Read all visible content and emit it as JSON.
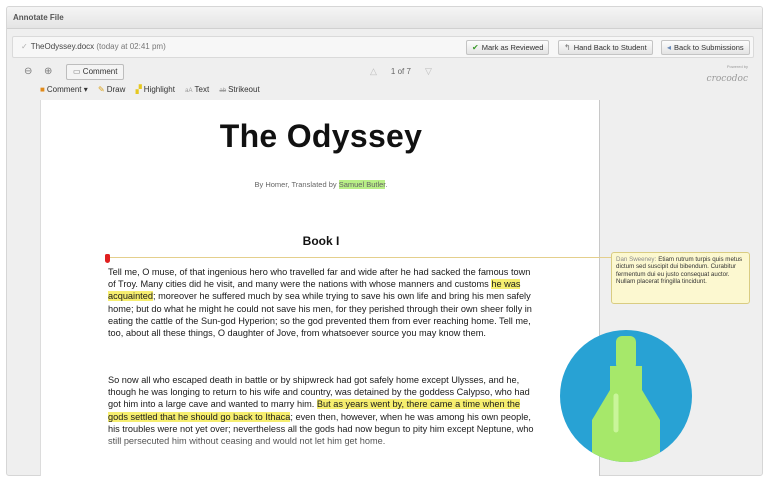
{
  "window": {
    "title": "Annotate File"
  },
  "file_bar": {
    "file_name": "TheOdyssey.docx",
    "timestamp": "(today at 02:41 pm)",
    "buttons": {
      "mark_reviewed": "Mark as Reviewed",
      "hand_back": "Hand Back to Student",
      "back_submissions": "Back to Submissions"
    }
  },
  "toolbar": {
    "comment_label": "Comment",
    "page_indicator": "1 of 7",
    "brand_powered": "Powered by",
    "brand_name": "crocodoc"
  },
  "annotation_tools": {
    "comment": "Comment",
    "draw": "Draw",
    "highlight": "Highlight",
    "text": "Text",
    "strikeout": "Strikeout"
  },
  "document": {
    "title": "The Odyssey",
    "byline_prefix": "By Homer, Translated by ",
    "byline_highlight": "Samuel Butler",
    "byline_suffix": ".",
    "book_heading": "Book I",
    "p1_a": "Tell me, O muse, of that ingenious hero who travelled far and wide after he had sacked the famous town of Troy. Many cities did he visit, and many were the nations with whose manners and customs ",
    "p1_hl": "he was acquainted",
    "p1_b": "; moreover he suffered much by sea while trying to save his own life and bring his men safely home; but do what he might he could not save his men, for they perished through their own sheer folly in eating the cattle of the Sun-god Hyperion; so the god prevented them from ever reaching home. Tell me, too, about all these things, O daughter of Jove, from whatsoever source you may know them.",
    "p2_a": "So now all who escaped death in battle or by shipwreck had got safely home except Ulysses, and he, though he was longing to return to his wife and country, was detained by the goddess Calypso, who had got him into a large cave and wanted to marry him. ",
    "p2_hl": "But as years went by, there came a time when the gods settled that he should go back to Ithaca",
    "p2_b": "; even then, however, when he was among his own people, his troubles were not yet over; nevertheless all the gods had now begun to pity him except Neptune, who still persecuted him without ceasing and would not let him get home."
  },
  "comment_note": {
    "author": "Dan Sweeney:",
    "text": "Etiam rutrum turpis quis metus dictum sed suscipit dui bibendum. Curabitur fermentum dui eu justo consequat auctor. Nullam placerat fringilla tincidunt."
  },
  "colors": {
    "highlight_yellow": "#f6ee6f",
    "highlight_green": "#b9ef87",
    "badge_blue": "#28a2d4",
    "marker_green": "#a6e86a",
    "pin_red": "#e02020"
  },
  "icons": [
    "zoom-out-icon",
    "zoom-in-icon",
    "speech-bubble-icon",
    "checkmark-icon",
    "arrow-left-icon",
    "prev-page-icon",
    "next-page-icon",
    "pencil-icon",
    "highlighter-icon",
    "highlighter-marker-icon"
  ]
}
